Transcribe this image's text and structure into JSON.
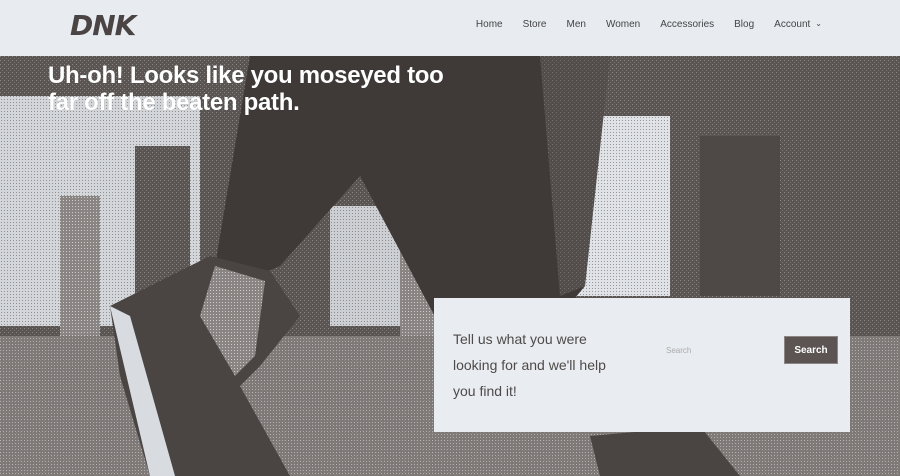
{
  "brand": {
    "logo_text": "DNK"
  },
  "nav": {
    "items": [
      {
        "label": "Home"
      },
      {
        "label": "Store"
      },
      {
        "label": "Men"
      },
      {
        "label": "Women"
      },
      {
        "label": "Accessories"
      },
      {
        "label": "Blog"
      },
      {
        "label": "Account",
        "has_dropdown": true
      }
    ],
    "chevron": "⌄"
  },
  "hero": {
    "headline": "Uh-oh! Looks like you moseyed too far off the beaten path.",
    "image_description_icon": "sneaker-on-road-photo"
  },
  "search_card": {
    "message": "Tell us what you were looking for and we'll help you find it!",
    "input_placeholder": "Search",
    "input_value": "",
    "button_label": "Search"
  },
  "colors": {
    "header_bg": "#e8ecf1",
    "hero_bg": "#57524f",
    "text_dark": "#4e4a49",
    "button_bg": "#5b5452",
    "card_bg": "#e9ecf0"
  }
}
